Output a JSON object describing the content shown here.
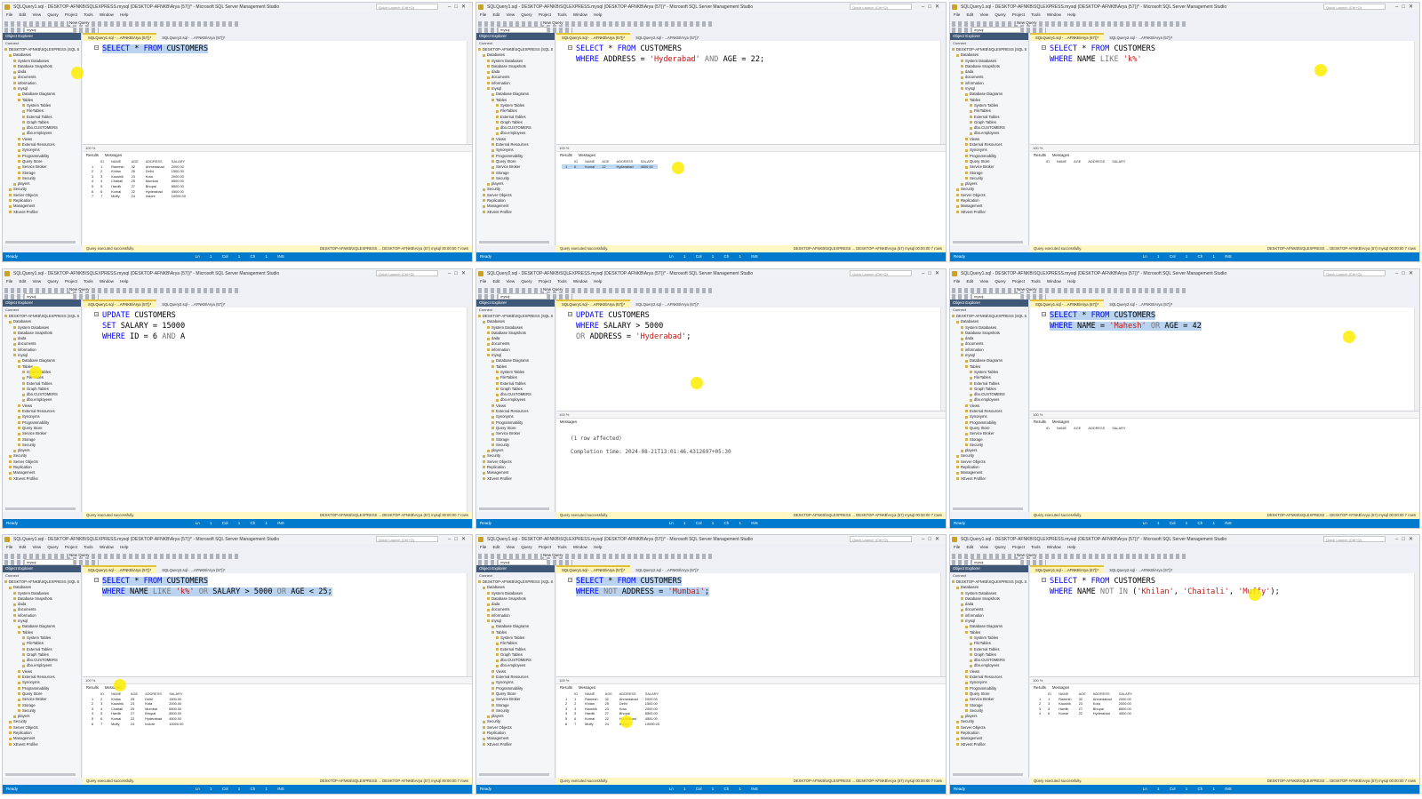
{
  "app": {
    "window_titles": [
      "SQLQuery1.sql - DESKTOP-AFNKB\\SQLEXPRESS.mysql (DESKTOP-AFNKB\\Arya (57))* - Microsoft SQL Server Management Studio",
      "SQLQuery1.sql - DESKTOP-AFNKB\\SQLEXPRESS.mysql (DESKTOP-AFNKB\\Arya (57))* - Microsoft SQL Server Management Studio",
      "SQLQuery1.sql - DESKTOP-AFNKB\\SQLEXPRESS.mysql (DESKTOP-AFNKB\\Arya (57))* - Microsoft SQL Server Management Studio",
      "SQLQuery1.sql - DESKTOP-AFNKB\\SQLEXPRESS.mysql (DESKTOP-AFNKB\\Arya (57))* - Microsoft SQL Server Management Studio",
      "SQLQuery2.sql - DESKTOP-AFNKB\\SQLEXPRESS.mysql (DESKTOP-AFNKB\\Arya (57))* - Microsoft SQL Server Management Studio",
      "SQLQuery1.sql - DESKTOP-AFNKB\\SQLEXPRESS.mysql (DESKTOP-AFNKB\\Arya (57))* - Microsoft SQL Server Management Studio",
      "SQLQuery1.sql - DESKTOP-AFNKB\\SQLEXPRESS.mysql (DESKTOP-AFNKB\\Arya (57))* - Microsoft SQL Server Management Studio",
      "SQLQuery1.sql - DESKTOP-AFNKB\\SQLEXPRESS.mysql (DESKTOP-AFNKB\\Arya (57))* - Microsoft SQL Server Management Studio",
      "SQLQuery1.sql - DESKTOP-AFNKB\\SQLEXPRESS.mysql (DESKTOP-AFNKB\\Arya (57))* - Microsoft SQL Server Management Studio"
    ],
    "quick_launch": "Quick Launch (Ctrl+Q)",
    "menu": "File Edit View Query Project Tools Window Help",
    "new_query": "New Query",
    "database": "mysql",
    "object_explorer_title": "Object Explorer",
    "connect": "Connect",
    "tab_label": "SQLQuery1.sql - ...AFNKB\\Arya (57))*",
    "tab_label_2": "SQLQuery2.sql - ...AFNKB\\Arya (57))*",
    "zoom": "100 %",
    "results_tab": "Results",
    "messages_tab": "Messages",
    "query_ok": "Query executed successfully.",
    "server_status": "DESKTOP-AFNKB\\SQLEXPRESS ... DESKTOP-AFNKB\\Arya (57) mysql 00:00:00 7 rows",
    "ready": "Ready",
    "ln_col": "Ln 1    Col 1    Ch 1    INS"
  },
  "tree": [
    {
      "label": "DESKTOP-AFNKB\\SQLEXPRESS (SQL S",
      "level": 0
    },
    {
      "label": "Databases",
      "level": 1
    },
    {
      "label": "System Databases",
      "level": 2
    },
    {
      "label": "Database Snapshots",
      "level": 2
    },
    {
      "label": "dada",
      "level": 2
    },
    {
      "label": "documents",
      "level": 2
    },
    {
      "label": "information",
      "level": 2
    },
    {
      "label": "mysql",
      "level": 2
    },
    {
      "label": "Database Diagrams",
      "level": 3
    },
    {
      "label": "Tables",
      "level": 3
    },
    {
      "label": "System Tables",
      "level": 4
    },
    {
      "label": "FileTables",
      "level": 4
    },
    {
      "label": "External Tables",
      "level": 4
    },
    {
      "label": "Graph Tables",
      "level": 4
    },
    {
      "label": "dbo.CUSTOMERS",
      "level": 4
    },
    {
      "label": "dbo.employees",
      "level": 4
    },
    {
      "label": "Views",
      "level": 3
    },
    {
      "label": "External Resources",
      "level": 3
    },
    {
      "label": "Synonyms",
      "level": 3
    },
    {
      "label": "Programmability",
      "level": 3
    },
    {
      "label": "Query Store",
      "level": 3
    },
    {
      "label": "Service Broker",
      "level": 3
    },
    {
      "label": "Storage",
      "level": 3
    },
    {
      "label": "Security",
      "level": 3
    },
    {
      "label": "players",
      "level": 2
    },
    {
      "label": "Security",
      "level": 1
    },
    {
      "label": "Server Objects",
      "level": 1
    },
    {
      "label": "Replication",
      "level": 1
    },
    {
      "label": "Management",
      "level": 1
    },
    {
      "label": "XEvent Profiler",
      "level": 1
    }
  ],
  "table_headers": [
    "ID",
    "NAME",
    "AGE",
    "ADDRESS",
    "SALARY"
  ],
  "panes": [
    {
      "code": [
        [
          {
            "t": "SELECT",
            "c": "kw"
          },
          {
            "t": " * "
          },
          {
            "t": "FROM",
            "c": "kw"
          },
          {
            "t": " CUSTOMERS"
          }
        ]
      ],
      "selected_lines": [
        0
      ],
      "cursor": [
        0.16,
        0.27
      ],
      "result_mode": "grid",
      "rows": [
        [
          "1",
          "Ramesh",
          "32",
          "Ahmedabad",
          "2000.00"
        ],
        [
          "2",
          "Khilan",
          "25",
          "Delhi",
          "1500.00"
        ],
        [
          "3",
          "Kaushik",
          "23",
          "Kota",
          "2000.00"
        ],
        [
          "4",
          "Chaitali",
          "25",
          "Mumbai",
          "6500.00"
        ],
        [
          "5",
          "Hardik",
          "27",
          "Bhopal",
          "8500.00"
        ],
        [
          "6",
          "Komal",
          "22",
          "Hyderabad",
          "4500.00"
        ],
        [
          "7",
          "Muffy",
          "24",
          "Indore",
          "10000.00"
        ]
      ],
      "highlight_rows": []
    },
    {
      "code": [
        [
          {
            "t": "SELECT",
            "c": "kw"
          },
          {
            "t": " * "
          },
          {
            "t": "FROM",
            "c": "kw"
          },
          {
            "t": " CUSTOMERS"
          }
        ],
        [
          {
            "t": "WHERE",
            "c": "kw"
          },
          {
            "t": " ADDRESS = "
          },
          {
            "t": "'Hyderabad'",
            "c": "str"
          },
          {
            "t": " "
          },
          {
            "t": "AND",
            "c": "gry"
          },
          {
            "t": " AGE = 22;"
          }
        ]
      ],
      "selected_lines": [],
      "cursor": [
        0.43,
        0.64
      ],
      "result_mode": "grid",
      "rows": [
        [
          "6",
          "Komal",
          "22",
          "Hyderabad",
          "4500.00"
        ]
      ],
      "highlight_rows": [
        0
      ]
    },
    {
      "code": [
        [
          {
            "t": "SELECT",
            "c": "kw"
          },
          {
            "t": " * "
          },
          {
            "t": "FROM",
            "c": "kw"
          },
          {
            "t": " CUSTOMERS"
          }
        ],
        [
          {
            "t": "WHERE",
            "c": "kw"
          },
          {
            "t": " NAME "
          },
          {
            "t": "LIKE",
            "c": "gry"
          },
          {
            "t": " "
          },
          {
            "t": "'k%'",
            "c": "str"
          }
        ]
      ],
      "selected_lines": [],
      "cursor": [
        0.79,
        0.26
      ],
      "result_mode": "grid",
      "rows": [],
      "highlight_rows": []
    },
    {
      "code": [
        [
          {
            "t": "UPDATE",
            "c": "kw"
          },
          {
            "t": " CUSTOMERS"
          }
        ],
        [
          {
            "t": "SET",
            "c": "kw"
          },
          {
            "t": " SALARY = 15000"
          }
        ],
        [
          {
            "t": "WHERE",
            "c": "kw"
          },
          {
            "t": " ID = 6 "
          },
          {
            "t": "AND",
            "c": "gry"
          },
          {
            "t": " A"
          }
        ]
      ],
      "selected_lines": [],
      "cursor": [
        0.07,
        0.4
      ],
      "result_mode": "none",
      "rows": [],
      "highlight_rows": []
    },
    {
      "code": [
        [
          {
            "t": "UPDATE",
            "c": "kw"
          },
          {
            "t": " CUSTOMERS"
          }
        ],
        [
          {
            "t": "WHERE",
            "c": "kw"
          },
          {
            "t": " SALARY > 5000"
          }
        ],
        [
          {
            "t": "OR",
            "c": "gry"
          },
          {
            "t": " ADDRESS = "
          },
          {
            "t": "'Hyderabad'",
            "c": "str"
          },
          {
            "t": ";"
          }
        ]
      ],
      "selected_lines": [],
      "cursor": [
        0.47,
        0.44
      ],
      "result_mode": "messages",
      "messages": [
        "(1 row affected)",
        "Completion time: 2024-08-21T13:01:46.4312697+05:30"
      ],
      "rows": [],
      "highlight_rows": []
    },
    {
      "code": [
        [
          {
            "t": "SELECT",
            "c": "kw"
          },
          {
            "t": " * "
          },
          {
            "t": "FROM",
            "c": "kw"
          },
          {
            "t": " CUSTOMERS"
          }
        ],
        [
          {
            "t": "WHERE",
            "c": "kw"
          },
          {
            "t": " NAME = "
          },
          {
            "t": "'Mahesh'",
            "c": "str"
          },
          {
            "t": " "
          },
          {
            "t": "OR",
            "c": "gry"
          },
          {
            "t": " AGE = 42"
          }
        ]
      ],
      "selected_lines": [
        0,
        1
      ],
      "cursor": [
        0.85,
        0.26
      ],
      "result_mode": "grid",
      "rows": [],
      "highlight_rows": []
    },
    {
      "code": [
        [
          {
            "t": "SELECT",
            "c": "kw"
          },
          {
            "t": " * "
          },
          {
            "t": "FROM",
            "c": "kw"
          },
          {
            "t": " CUSTOMERS"
          }
        ],
        [
          {
            "t": "WHERE",
            "c": "kw"
          },
          {
            "t": " NAME "
          },
          {
            "t": "LIKE",
            "c": "gry"
          },
          {
            "t": " "
          },
          {
            "t": "'k%'",
            "c": "str"
          },
          {
            "t": " "
          },
          {
            "t": "OR",
            "c": "gry"
          },
          {
            "t": " SALARY > 5000 "
          },
          {
            "t": "OR",
            "c": "gry"
          },
          {
            "t": " AGE < 25;"
          }
        ]
      ],
      "selected_lines": [
        0,
        1
      ],
      "cursor": [
        0.25,
        0.58
      ],
      "result_mode": "grid",
      "rows": [
        [
          "2",
          "Khilan",
          "25",
          "Delhi",
          "1500.00"
        ],
        [
          "3",
          "Kaushik",
          "23",
          "Kota",
          "2000.00"
        ],
        [
          "4",
          "Chaitali",
          "25",
          "Mumbai",
          "6500.00"
        ],
        [
          "5",
          "Hardik",
          "27",
          "Bhopal",
          "8500.00"
        ],
        [
          "6",
          "Komal",
          "22",
          "Hyderabad",
          "4500.00"
        ],
        [
          "7",
          "Muffy",
          "24",
          "Indore",
          "10000.00"
        ]
      ],
      "highlight_rows": []
    },
    {
      "code": [
        [
          {
            "t": "SELECT",
            "c": "kw"
          },
          {
            "t": " * "
          },
          {
            "t": "FROM",
            "c": "kw"
          },
          {
            "t": " CUSTOMERS"
          }
        ],
        [
          {
            "t": "WHERE",
            "c": "kw"
          },
          {
            "t": " "
          },
          {
            "t": "NOT",
            "c": "gry"
          },
          {
            "t": " ADDRESS = "
          },
          {
            "t": "'Mumbai'",
            "c": "str"
          },
          {
            "t": ";"
          }
        ]
      ],
      "selected_lines": [
        0,
        1
      ],
      "cursor": [
        0.32,
        0.72
      ],
      "result_mode": "grid",
      "rows": [
        [
          "1",
          "Ramesh",
          "32",
          "Ahmedabad",
          "2000.00"
        ],
        [
          "2",
          "Khilan",
          "25",
          "Delhi",
          "1500.00"
        ],
        [
          "3",
          "Kaushik",
          "23",
          "Kota",
          "2000.00"
        ],
        [
          "5",
          "Hardik",
          "27",
          "Bhopal",
          "8500.00"
        ],
        [
          "6",
          "Komal",
          "22",
          "Hyderabad",
          "4500.00"
        ],
        [
          "7",
          "Muffy",
          "24",
          "Indore",
          "10000.00"
        ]
      ],
      "highlight_rows": []
    },
    {
      "code": [
        [
          {
            "t": "SELECT",
            "c": "kw"
          },
          {
            "t": " * "
          },
          {
            "t": "FROM",
            "c": "kw"
          },
          {
            "t": " CUSTOMERS"
          }
        ],
        [
          {
            "t": "WHERE",
            "c": "kw"
          },
          {
            "t": " NAME "
          },
          {
            "t": "NOT IN",
            "c": "gry"
          },
          {
            "t": " ("
          },
          {
            "t": "'Khilan'",
            "c": "str"
          },
          {
            "t": ", "
          },
          {
            "t": "'Chaitali'",
            "c": "str"
          },
          {
            "t": ", "
          },
          {
            "t": "'Muffy'",
            "c": "str"
          },
          {
            "t": ");"
          }
        ]
      ],
      "selected_lines": [],
      "cursor": [
        0.65,
        0.23
      ],
      "result_mode": "grid",
      "rows": [
        [
          "1",
          "Ramesh",
          "32",
          "Ahmedabad",
          "2000.00"
        ],
        [
          "3",
          "Kaushik",
          "23",
          "Kota",
          "2000.00"
        ],
        [
          "5",
          "Hardik",
          "27",
          "Bhopal",
          "8500.00"
        ],
        [
          "6",
          "Komal",
          "22",
          "Hyderabad",
          "4500.00"
        ]
      ],
      "highlight_rows": []
    }
  ]
}
